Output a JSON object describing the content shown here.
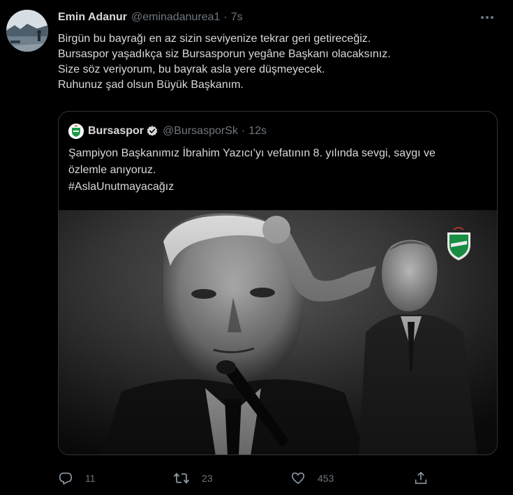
{
  "author": {
    "name": "Emin Adanur",
    "handle": "@eminadanurea1",
    "separator": "·",
    "time": "7s"
  },
  "tweet_lines": [
    "Birgün bu bayrağı en az sizin seviyenize tekrar geri getireceğiz.",
    "Bursaspor yaşadıkça siz Bursasporun yegâne Başkanı olacaksınız.",
    "Size söz veriyorum, bu bayrak asla yere düşmeyecek.",
    "Ruhunuz şad olsun Büyük Başkanım."
  ],
  "quote": {
    "name": "Bursaspor",
    "handle": "@BursasporSk",
    "separator": "·",
    "time": "12s",
    "lines": [
      "Şampiyon Başkanımız İbrahim Yazıcı’yı vefatının 8. yılında sevgi, saygı ve",
      "özlemle anıyoruz."
    ],
    "hashtag": "#AslaUnutmayacağız"
  },
  "actions": {
    "reply_count": "11",
    "retweet_count": "23",
    "like_count": "453"
  },
  "icons": {
    "reply": "reply-icon",
    "retweet": "retweet-icon",
    "like": "heart-icon",
    "share": "share-icon",
    "more": "more-icon",
    "verified": "verified-badge-icon"
  },
  "colors": {
    "background": "#000000",
    "text": "#d9d9d9",
    "muted": "#6e767d",
    "border": "#2f3336",
    "brand_green": "#1a9a48"
  }
}
